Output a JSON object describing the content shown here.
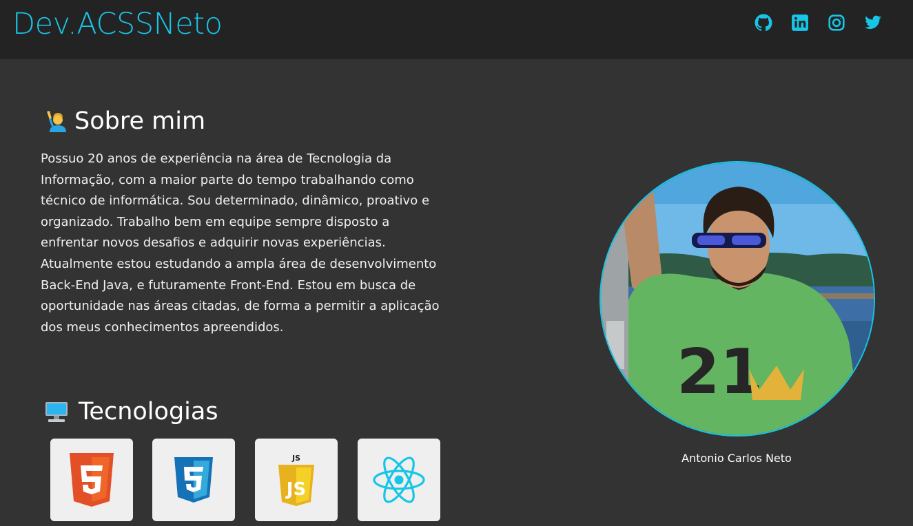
{
  "header": {
    "brand": "Dev.ACSSNeto",
    "accent_color": "#17c6e6",
    "social": [
      {
        "icon": "github-icon",
        "label": "GitHub"
      },
      {
        "icon": "linkedin-icon",
        "label": "LinkedIn"
      },
      {
        "icon": "instagram-icon",
        "label": "Instagram"
      },
      {
        "icon": "twitter-icon",
        "label": "Twitter"
      }
    ]
  },
  "about": {
    "emoji": "🙋‍♂️",
    "title": "Sobre mim",
    "lines": [
      "Possuo 20 anos de experiência na área de Tecnologia da",
      "Informação, com a maior parte do tempo trabalhando como",
      "técnico de informática. Sou determinado, dinâmico, proativo e",
      "organizado. Trabalho bem em equipe sempre disposto a",
      "enfrentar novos desafios e adquirir novas experiências.",
      "Atualmente estou estudando a ampla área de desenvolvimento",
      "Back-End Java, e futuramente Front-End. Estou em busca de",
      "oportunidade nas áreas citadas, de forma a permitir a aplicação",
      "dos meus conhecimentos apreendidos."
    ]
  },
  "profile": {
    "caption": "Antonio Carlos Neto"
  },
  "technologies": {
    "emoji": "🖥️",
    "title": "Tecnologias",
    "items": [
      {
        "name": "HTML5",
        "icon": "html5-icon"
      },
      {
        "name": "CSS3",
        "icon": "css3-icon"
      },
      {
        "name": "JavaScript",
        "icon": "javascript-icon",
        "badge": "JS"
      },
      {
        "name": "React",
        "icon": "react-icon"
      }
    ]
  }
}
